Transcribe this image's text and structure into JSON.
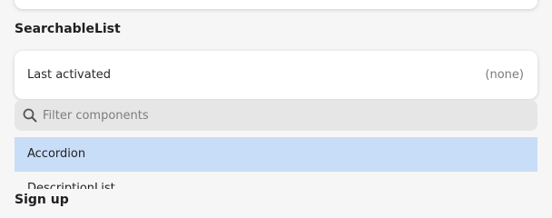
{
  "searchable_list": {
    "title": "SearchableList",
    "last_activated": {
      "label": "Last activated",
      "value": "(none)"
    },
    "filter": {
      "placeholder": "Filter components",
      "value": ""
    },
    "items": [
      {
        "label": "Accordion",
        "selected": true
      },
      {
        "label": "DescriptionList",
        "selected": false
      }
    ]
  },
  "next_section": {
    "title": "Sign up"
  },
  "colors": {
    "background": "#f6f6f6",
    "card": "#ffffff",
    "search_bg": "#e6e6e6",
    "selected_item": "#c8ddf7",
    "muted_text": "#7a7a7a"
  },
  "icons": {
    "search": "search-icon"
  }
}
